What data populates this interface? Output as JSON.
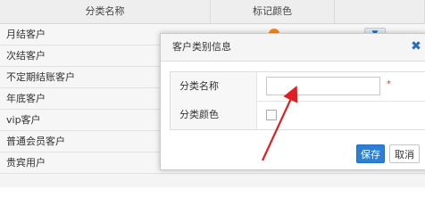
{
  "table": {
    "headers": {
      "name": "分类名称",
      "color": "标记颜色"
    },
    "rows": [
      {
        "name": "月结客户",
        "has_dot": true,
        "has_button": true
      },
      {
        "name": "次结客户"
      },
      {
        "name": "不定期结账客户"
      },
      {
        "name": "年底客户"
      },
      {
        "name": "vip客户"
      },
      {
        "name": "普通会员客户"
      },
      {
        "name": "贵宾用户"
      }
    ],
    "row_button_icon": "chevron-down-icon",
    "dot_color": "#f08a24"
  },
  "dialog": {
    "title": "客户类别信息",
    "close_icon": "close-icon",
    "fields": {
      "name_label": "分类名称",
      "name_value": "",
      "required_mark": "*",
      "color_label": "分类颜色"
    },
    "save_label": "保存",
    "cancel_label": "取消"
  },
  "annotation": {
    "arrow_color": "#e02020"
  },
  "colors": {
    "accent": "#2d7fd6"
  }
}
